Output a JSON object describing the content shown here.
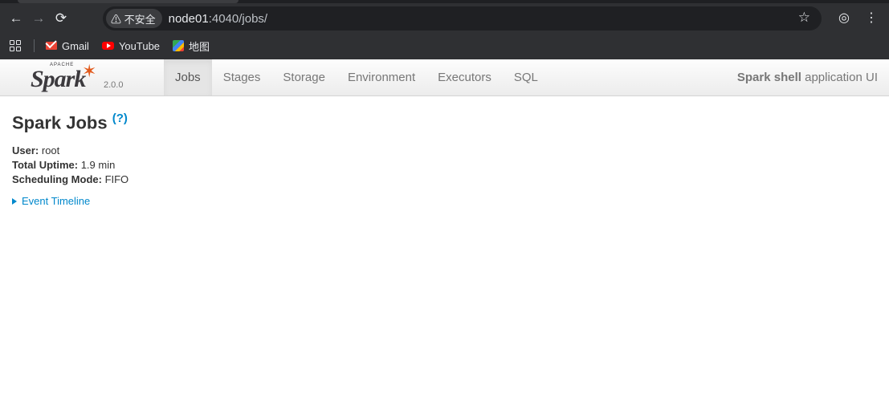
{
  "browser": {
    "back_icon": "←",
    "forward_icon": "→",
    "reload_icon": "⟳",
    "security_chip": "⚠ 不安全",
    "url_host": "node01",
    "url_path": ":4040/jobs/",
    "star_icon": "☆",
    "profile_icon": "◎",
    "menu_icon": "⋮"
  },
  "bookmarks": [
    {
      "label": "Gmail"
    },
    {
      "label": "YouTube"
    },
    {
      "label": "地图"
    }
  ],
  "spark": {
    "logo_text": "Spark",
    "logo_apache": "APACHE",
    "version": "2.0.0",
    "tabs": [
      {
        "label": "Jobs",
        "active": true
      },
      {
        "label": "Stages"
      },
      {
        "label": "Storage"
      },
      {
        "label": "Environment"
      },
      {
        "label": "Executors"
      },
      {
        "label": "SQL"
      }
    ],
    "app_name_bold": "Spark shell",
    "app_name_rest": " application UI"
  },
  "page": {
    "title": "Spark Jobs ",
    "help": "(?)",
    "user_label": "User:",
    "user_value": " root",
    "uptime_label": "Total Uptime:",
    "uptime_value": " 1.9 min",
    "scheduling_label": "Scheduling Mode:",
    "scheduling_value": " FIFO",
    "event_timeline": "Event Timeline"
  },
  "colors": {
    "link": "#0088cc",
    "spark_orange": "#e25a1c"
  }
}
